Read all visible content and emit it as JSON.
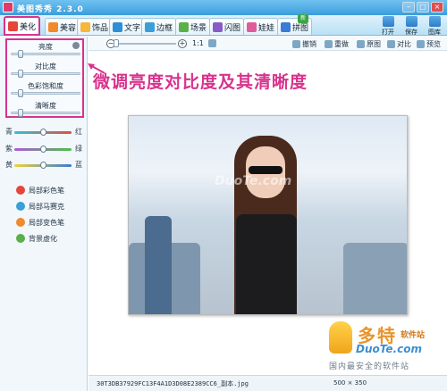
{
  "window": {
    "title": "美图秀秀 2.3.0"
  },
  "tabs": [
    {
      "label": "美化",
      "active": true,
      "color": "#e5463a"
    },
    {
      "label": "美容",
      "active": false,
      "color": "#f08a2a"
    },
    {
      "label": "饰品",
      "active": false,
      "color": "#f6b73a"
    },
    {
      "label": "文字",
      "active": false,
      "color": "#2f8ed6"
    },
    {
      "label": "边框",
      "active": false,
      "color": "#3a9fd9"
    },
    {
      "label": "场景",
      "active": false,
      "color": "#5ab04a"
    },
    {
      "label": "闪图",
      "active": false,
      "color": "#8a5ac8"
    },
    {
      "label": "娃娃",
      "active": false,
      "color": "#e05b9a"
    },
    {
      "label": "拼图",
      "active": false,
      "color": "#3a7bd5"
    }
  ],
  "new_badge": "新",
  "file_actions": [
    "打开",
    "保存",
    "图库"
  ],
  "adjustments": [
    {
      "label": "亮度",
      "level": 0.1
    },
    {
      "label": "对比度",
      "level": 0.1
    },
    {
      "label": "色彩饱和度",
      "level": 0.1
    },
    {
      "label": "清晰度",
      "level": 0.1
    }
  ],
  "color_balance": [
    {
      "left": "青",
      "right": "红",
      "gradient": [
        "#2ec4d6",
        "#e64b3c"
      ],
      "level": 0.5
    },
    {
      "left": "紫",
      "right": "绿",
      "gradient": [
        "#b05ad6",
        "#4cc04a"
      ],
      "level": 0.5
    },
    {
      "left": "黄",
      "right": "蓝",
      "gradient": [
        "#f0d23a",
        "#3a7bd5"
      ],
      "level": 0.5
    }
  ],
  "local_tools": [
    {
      "label": "局部彩色笔",
      "color": "#e5463a"
    },
    {
      "label": "局部马赛克",
      "color": "#3a9fd9"
    },
    {
      "label": "局部变色笔",
      "color": "#f08a2a"
    },
    {
      "label": "背景虚化",
      "color": "#5ab04a"
    }
  ],
  "zoom": {
    "ratio_label": "1:1",
    "fit_label": ""
  },
  "edit_actions": [
    "撤销",
    "重做",
    "原图",
    "对比",
    "预览"
  ],
  "callout": "微调亮度对比度及其清晰度",
  "photo_watermark": "DuoTe.com",
  "status": {
    "filename": "30T3DB37929FC13F4A1D3D08E2389CC6_副本.jpg",
    "dimensions": "500 × 350"
  },
  "logo": {
    "cn": "多特",
    "small": "软件站",
    "en": "DuoTe.com",
    "tag": "国内最安全的软件站"
  }
}
